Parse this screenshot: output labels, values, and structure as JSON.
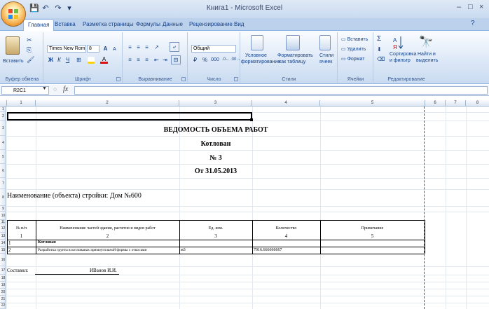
{
  "window": {
    "title": "Книга1 - Microsoft Excel"
  },
  "tabs": [
    {
      "label": "Главная"
    },
    {
      "label": "Вставка"
    },
    {
      "label": "Разметка страницы"
    },
    {
      "label": "Формулы"
    },
    {
      "label": "Данные"
    },
    {
      "label": "Рецензирование"
    },
    {
      "label": "Вид"
    }
  ],
  "ribbon": {
    "clipboard": {
      "label": "Буфер обмена",
      "paste": "Вставить"
    },
    "font": {
      "label": "Шрифт",
      "name": "Times New Rom",
      "size": "8",
      "bold": "Ж",
      "italic": "К",
      "underline": "Ч",
      "grow": "A",
      "shrink": "A"
    },
    "alignment": {
      "label": "Выравнивание"
    },
    "number": {
      "label": "Число",
      "format": "Общий",
      "percent": "%",
      "thousands": "000"
    },
    "styles": {
      "label": "Стили",
      "conditional": "Условное",
      "conditional2": "форматирование",
      "format_table": "Форматировать",
      "format_table2": "как таблицу",
      "cell_styles": "Стили",
      "cell_styles2": "ячеек"
    },
    "cells": {
      "label": "Ячейки",
      "insert": "Вставить",
      "delete": "Удалить",
      "format": "Формат"
    },
    "editing": {
      "label": "Редактирование",
      "sum": "Σ",
      "sort": "Сортировка",
      "sort2": "и фильтр",
      "find": "Найти и",
      "find2": "выделить"
    }
  },
  "formula_bar": {
    "name_box": "R2C1",
    "fx": "fx",
    "value": ""
  },
  "columns": [
    "1",
    "2",
    "3",
    "4",
    "5",
    "6",
    "7",
    "8"
  ],
  "rows": [
    "1",
    "2",
    "3",
    "4",
    "5",
    "6",
    "7",
    "8",
    "9",
    "10",
    "11",
    "12",
    "13",
    "14",
    "15",
    "16",
    "17",
    "18",
    "19",
    "20",
    "21",
    "22"
  ],
  "sheet": {
    "title": "ВЕДОМОСТЬ ОБЪЕМА РАБОТ",
    "subtitle": "Котлован",
    "number": "№ 3",
    "date": "От 31.05.2013",
    "object": "Наименование (объекта) стройки: Дом №600",
    "headers": [
      "№ п/п",
      "Наименование частей здания, расчетов и видов работ",
      "Ед. изм.",
      "Количество",
      "Примечание"
    ],
    "header_nums": [
      "1",
      "2",
      "3",
      "4",
      "5"
    ],
    "section_num": "1",
    "section": "Котлован",
    "row_num": "2",
    "work": "Разработка грунта в котлованах прямоугольной формы с откосами",
    "unit": "м3",
    "qty": "7916.666666667",
    "composed_label": "Составил:",
    "composed_name": "ИВанов И.И."
  },
  "colors": {
    "accent": "#15428b",
    "ribbon": "#dbe7f6"
  }
}
